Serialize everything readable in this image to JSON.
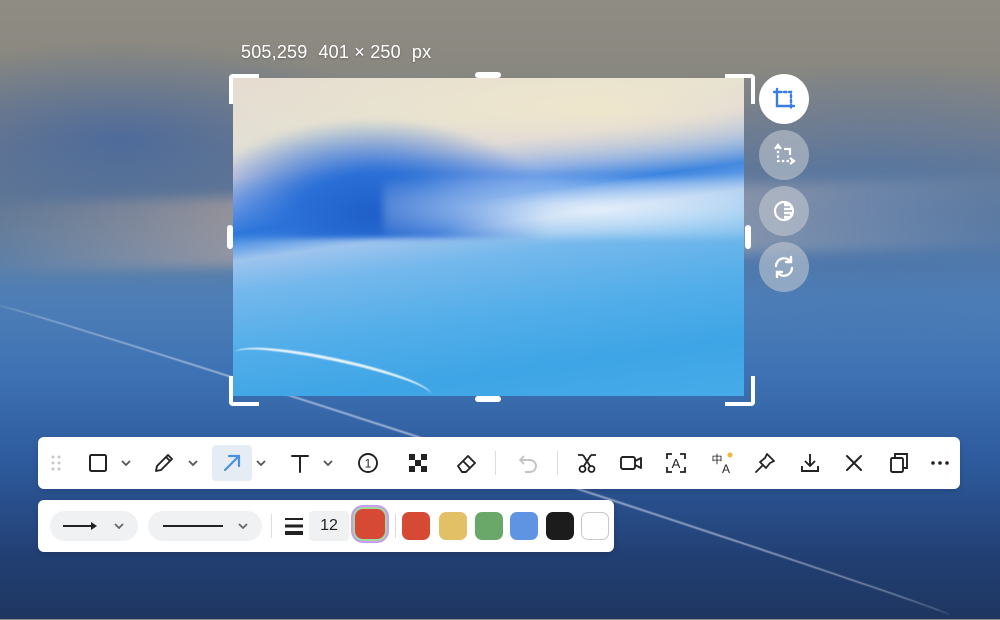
{
  "selection_info": {
    "position": "505,259",
    "size": "401 × 250",
    "unit": "px"
  },
  "side_tools": [
    {
      "name": "crop-tool",
      "icon": "crop-icon",
      "active": true
    },
    {
      "name": "resize-tool",
      "icon": "resize-arrows-icon",
      "active": false
    },
    {
      "name": "contrast-tool",
      "icon": "contrast-icon",
      "active": false
    },
    {
      "name": "rotate-tool",
      "icon": "refresh-icon",
      "active": false
    }
  ],
  "toolbar": {
    "tools": [
      {
        "name": "rectangle-tool",
        "icon": "rectangle-icon",
        "has_dropdown": true
      },
      {
        "name": "pen-tool",
        "icon": "pencil-icon",
        "has_dropdown": true
      },
      {
        "name": "arrow-tool",
        "icon": "arrow-icon",
        "has_dropdown": true,
        "selected": true
      },
      {
        "name": "text-tool",
        "icon": "text-icon",
        "has_dropdown": true
      },
      {
        "name": "number-tool",
        "icon": "numbered-circle-icon",
        "label": "1"
      },
      {
        "name": "mosaic-tool",
        "icon": "mosaic-icon"
      },
      {
        "name": "eraser-tool",
        "icon": "eraser-icon"
      },
      {
        "name": "undo-button",
        "icon": "undo-icon",
        "disabled": true
      },
      {
        "name": "scissors-button",
        "icon": "scissors-icon"
      },
      {
        "name": "record-button",
        "icon": "video-camera-icon"
      },
      {
        "name": "ocr-button",
        "icon": "text-recognition-icon",
        "label": "A"
      },
      {
        "name": "translate-button",
        "icon": "translate-icon",
        "label_cn": "中",
        "label_en": "A"
      },
      {
        "name": "pin-button",
        "icon": "pin-icon"
      },
      {
        "name": "download-button",
        "icon": "download-icon"
      },
      {
        "name": "close-button",
        "icon": "close-icon"
      },
      {
        "name": "copy-button",
        "icon": "copy-icon"
      },
      {
        "name": "more-button",
        "icon": "more-icon"
      }
    ]
  },
  "stylebar": {
    "arrow_style": "arrow-line",
    "line_style": "solid-line",
    "stroke_size": "12",
    "current_color": "#d64a35",
    "colors": [
      "#d64a35",
      "#e2c066",
      "#6aa86a",
      "#5e94e2",
      "#1c1c1c",
      "#ffffff"
    ]
  },
  "colors": {
    "accent": "#4a90e2",
    "icon": "#222222",
    "disabled_icon": "#c4c4c4"
  }
}
